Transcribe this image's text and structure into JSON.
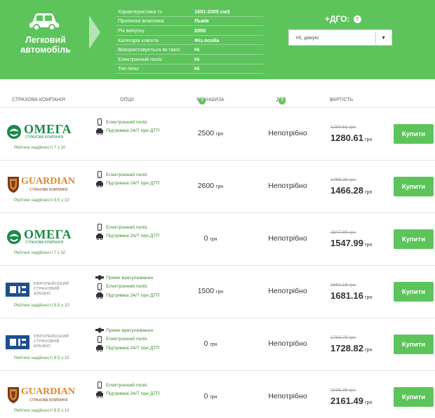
{
  "header": {
    "car_title": "Легковий автомобіль",
    "params": [
      {
        "label": "Характеристика тз",
        "value": "1601-2000 см3"
      },
      {
        "label": "Прописка власника",
        "value": "Львів"
      },
      {
        "label": "Рік випуску",
        "value": "2000"
      },
      {
        "label": "Категорія клієнта",
        "value": "Фіз.особа"
      },
      {
        "label": "Використовується як таксі",
        "value": "Ні"
      },
      {
        "label": "Електронний поліс",
        "value": "Ні"
      },
      {
        "label": "Тип пільг",
        "value": "Ні"
      }
    ],
    "dgo_title": "+ДГО:",
    "dgo_help": "?",
    "dgo_select_value": "Ні, дякую",
    "dgo_caret": "▼"
  },
  "table": {
    "headers": {
      "company": "СТРАХОВА КОМПАНІЯ",
      "options": "ОПЦІЇ",
      "franchise": "ФРАНШИЗА",
      "dgo": "ДГО",
      "price": "ВАРТІСТЬ",
      "help": "?",
      "sort_arrow": "↑"
    },
    "rows": [
      {
        "company": "omega",
        "logo_text": "ОМЕГА",
        "logo_sub": "СТРАХОВА КОМПАНІЯ",
        "rating": "Рейтинг надійності 7 з 10",
        "options": [
          {
            "icon": "phone-icon",
            "label": "Електронний поліс"
          },
          {
            "icon": "car-crash-icon",
            "label": "Підтримка 24/7 при ДТП"
          }
        ],
        "franchise": "2500",
        "currency": "грн",
        "dgo": "Непотрібно",
        "old_price": "1280.61 грн",
        "price": "1280.61",
        "buy": "Купити"
      },
      {
        "company": "guardian",
        "logo_text": "GUARDIAN",
        "logo_sub": "СТРАХОВА КОМПАНІЯ",
        "rating": "Рейтинг надійності 9.5 з 10",
        "options": [
          {
            "icon": "phone-icon",
            "label": "Електронний поліс"
          },
          {
            "icon": "car-crash-icon",
            "label": "Підтримка 24/7 при ДТП"
          }
        ],
        "franchise": "2600",
        "currency": "грн",
        "dgo": "Непотрібно",
        "old_price": "1466.28 грн",
        "price": "1466.28",
        "buy": "Купити"
      },
      {
        "company": "omega",
        "logo_text": "ОМЕГА",
        "logo_sub": "СТРАХОВА КОМПАНІЯ",
        "rating": "Рейтинг надійності 7 з 10",
        "options": [
          {
            "icon": "phone-icon",
            "label": "Електронний поліс"
          },
          {
            "icon": "car-crash-icon",
            "label": "Підтримка 24/7 при ДТП"
          }
        ],
        "franchise": "0",
        "currency": "грн",
        "dgo": "Непотрібно",
        "old_price": "1547.99 грн",
        "price": "1547.99",
        "buy": "Купити"
      },
      {
        "company": "euro-alliance",
        "logo_text": "ЄВРОПЕЙСЬКИЙ СТРАХОВИЙ АЛЬЯНС",
        "logo_sub": "",
        "rating": "Рейтинг надійності 9.5 з 10",
        "options": [
          {
            "icon": "handshake-icon",
            "label": "Пряме врегулювання"
          },
          {
            "icon": "phone-icon",
            "label": "Електронний поліс"
          },
          {
            "icon": "car-crash-icon",
            "label": "Підтримка 24/7 при ДТП"
          }
        ],
        "franchise": "1500",
        "currency": "грн",
        "dgo": "Непотрібно",
        "old_price": "1681.16 грн",
        "price": "1681.16",
        "buy": "Купити"
      },
      {
        "company": "euro-alliance",
        "logo_text": "ЄВРОПЕЙСЬКИЙ СТРАХОВИЙ АЛЬЯНС",
        "logo_sub": "",
        "rating": "Рейтинг надійності 9.5 з 10",
        "options": [
          {
            "icon": "handshake-icon",
            "label": "Пряме врегулювання"
          },
          {
            "icon": "phone-icon",
            "label": "Електронний поліс"
          },
          {
            "icon": "car-crash-icon",
            "label": "Підтримка 24/7 при ДТП"
          }
        ],
        "franchise": "0",
        "currency": "грн",
        "dgo": "Непотрібно",
        "old_price": "1782.79 грн",
        "price": "1728.82",
        "buy": "Купити"
      },
      {
        "company": "guardian",
        "logo_text": "GUARDIAN",
        "logo_sub": "СТРАХОВА КОМПАНІЯ",
        "rating": "Рейтинг надійності 9.5 з 10",
        "options": [
          {
            "icon": "phone-icon",
            "label": "Електронний поліс"
          },
          {
            "icon": "car-crash-icon",
            "label": "Підтримка 24/7 при ДТП"
          }
        ],
        "franchise": "0",
        "currency": "грн",
        "dgo": "Непотрібно",
        "old_price": "2235.26 грн",
        "price": "2161.49",
        "buy": "Купити"
      }
    ]
  },
  "colors": {
    "brand_green": "#5cc45a",
    "omega_green": "#1a8a4a",
    "guardian_orange": "#d9882b",
    "euro_blue": "#1d4f8f"
  }
}
